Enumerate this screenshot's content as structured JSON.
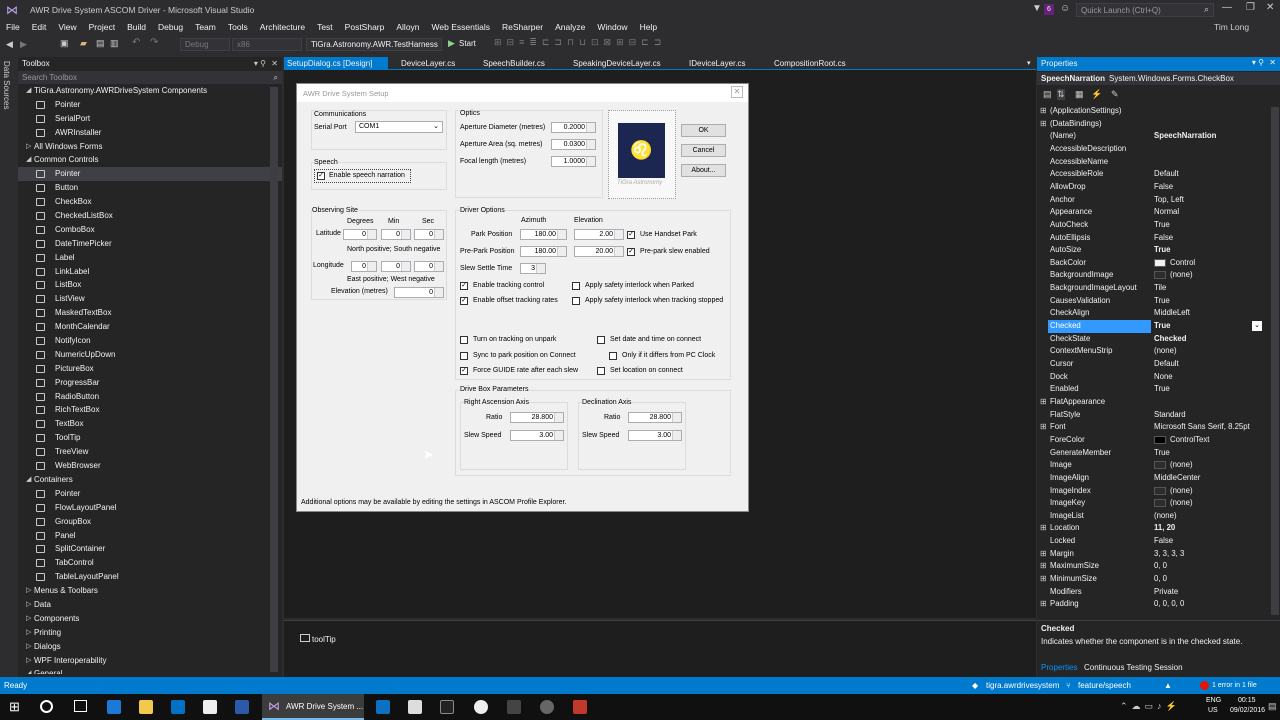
{
  "window": {
    "title": "AWR Drive System ASCOM Driver - Microsoft Visual Studio",
    "quick_launch": "Quick Launch (Ctrl+Q)",
    "user": "Tim Long",
    "notif_count": "6"
  },
  "menu": [
    "File",
    "Edit",
    "View",
    "Project",
    "Build",
    "Debug",
    "Team",
    "Tools",
    "Architecture",
    "Test",
    "PostSharp",
    "Alloyn",
    "Web Essentials",
    "ReSharper",
    "Analyze",
    "Window",
    "Help"
  ],
  "toolbar": {
    "config": "Debug",
    "platform": "x86",
    "startup": "TiGra.Astronomy.AWR.TestHarness",
    "start": "Start"
  },
  "sidestrip": {
    "label": "Data Sources"
  },
  "toolbox": {
    "title": "Toolbox",
    "search": "Search Toolbox",
    "items": [
      {
        "t": "TiGra.Astronomy.AWRDriveSystem Components",
        "lvl": 0,
        "grp": true
      },
      {
        "t": "Pointer",
        "lvl": 1
      },
      {
        "t": "SerialPort",
        "lvl": 1
      },
      {
        "t": "AWRInstaller",
        "lvl": 1
      },
      {
        "t": "All Windows Forms",
        "lvl": 0,
        "grp": true,
        "col": true
      },
      {
        "t": "Common Controls",
        "lvl": 0,
        "grp": true
      },
      {
        "t": "Pointer",
        "lvl": 1,
        "sel": true
      },
      {
        "t": "Button",
        "lvl": 1
      },
      {
        "t": "CheckBox",
        "lvl": 1
      },
      {
        "t": "CheckedListBox",
        "lvl": 1
      },
      {
        "t": "ComboBox",
        "lvl": 1
      },
      {
        "t": "DateTimePicker",
        "lvl": 1
      },
      {
        "t": "Label",
        "lvl": 1
      },
      {
        "t": "LinkLabel",
        "lvl": 1
      },
      {
        "t": "ListBox",
        "lvl": 1
      },
      {
        "t": "ListView",
        "lvl": 1
      },
      {
        "t": "MaskedTextBox",
        "lvl": 1
      },
      {
        "t": "MonthCalendar",
        "lvl": 1
      },
      {
        "t": "NotifyIcon",
        "lvl": 1
      },
      {
        "t": "NumericUpDown",
        "lvl": 1
      },
      {
        "t": "PictureBox",
        "lvl": 1
      },
      {
        "t": "ProgressBar",
        "lvl": 1
      },
      {
        "t": "RadioButton",
        "lvl": 1
      },
      {
        "t": "RichTextBox",
        "lvl": 1
      },
      {
        "t": "TextBox",
        "lvl": 1
      },
      {
        "t": "ToolTip",
        "lvl": 1
      },
      {
        "t": "TreeView",
        "lvl": 1
      },
      {
        "t": "WebBrowser",
        "lvl": 1
      },
      {
        "t": "Containers",
        "lvl": 0,
        "grp": true
      },
      {
        "t": "Pointer",
        "lvl": 1
      },
      {
        "t": "FlowLayoutPanel",
        "lvl": 1
      },
      {
        "t": "GroupBox",
        "lvl": 1
      },
      {
        "t": "Panel",
        "lvl": 1
      },
      {
        "t": "SplitContainer",
        "lvl": 1
      },
      {
        "t": "TabControl",
        "lvl": 1
      },
      {
        "t": "TableLayoutPanel",
        "lvl": 1
      },
      {
        "t": "Menus & Toolbars",
        "lvl": 0,
        "grp": true,
        "col": true
      },
      {
        "t": "Data",
        "lvl": 0,
        "grp": true,
        "col": true
      },
      {
        "t": "Components",
        "lvl": 0,
        "grp": true,
        "col": true
      },
      {
        "t": "Printing",
        "lvl": 0,
        "grp": true,
        "col": true
      },
      {
        "t": "Dialogs",
        "lvl": 0,
        "grp": true,
        "col": true
      },
      {
        "t": "WPF Interoperability",
        "lvl": 0,
        "grp": true,
        "col": true
      },
      {
        "t": "General",
        "lvl": 0,
        "grp": true
      }
    ]
  },
  "tabs": [
    "SetupDialog.cs [Design]",
    "DeviceLayer.cs",
    "SpeechBuilder.cs",
    "SpeakingDeviceLayer.cs",
    "IDeviceLayer.cs",
    "CompositionRoot.cs"
  ],
  "dialog": {
    "title": "AWR Drive System Setup",
    "comms": {
      "title": "Communications",
      "port_label": "Serial Port",
      "port": "COM1"
    },
    "speech": {
      "title": "Speech",
      "enable": "Enable speech narration"
    },
    "optics": {
      "title": "Optics",
      "ap_diam": "Aperture Diameter (metres)",
      "ap_diam_v": "0.2000",
      "ap_area": "Aperture Area (sq. metres)",
      "ap_area_v": "0.0300",
      "focal": "Focal length (metres)",
      "focal_v": "1.0000"
    },
    "logo_caption": "TiGra Astronomy",
    "ok": "OK",
    "cancel": "Cancel",
    "about": "About...",
    "site": {
      "title": "Observing Site",
      "deg": "Degrees",
      "min": "Min",
      "sec": "Sec",
      "lat": "Latitude",
      "lon": "Longitude",
      "ns": "North positive; South negative",
      "ew": "East positive; West negative",
      "elev": "Elevation (metres)",
      "v0": "0"
    },
    "driver": {
      "title": "Driver Options",
      "az": "Azimuth",
      "el": "Elevation",
      "park": "Park Position",
      "park_az": "180.00",
      "park_el": "2.00",
      "prepark": "Pre-Park Position",
      "prepark_az": "180.00",
      "prepark_el": "20.00",
      "settle": "Slew Settle Time",
      "settle_v": "3",
      "handset": "Use Handset Park",
      "preslew": "Pre-park slew enabled",
      "track": "Enable tracking control",
      "offset": "Enable offset tracking rates",
      "safe_park": "Apply safety interlock when Parked",
      "safe_stop": "Apply safety interlock when tracking stopped",
      "unpark": "Turn on tracking on unpark",
      "sync": "Sync to park position on Connect",
      "guide": "Force GUIDE rate after each slew",
      "setdate": "Set date and time on connect",
      "ifdiff": "Only if it differs from PC Clock",
      "setloc": "Set location on connect"
    },
    "drive": {
      "title": "Drive Box Parameters",
      "ra": "Right Ascension Axis",
      "dec": "Declination Axis",
      "ratio": "Ratio",
      "ratio_v": "28.800",
      "slew": "Slew Speed",
      "slew_v": "3.00"
    },
    "footer": "Additional options may be available by editing the settings in ASCOM Profile Explorer."
  },
  "tray": {
    "item": "toolTip"
  },
  "props": {
    "title": "Properties",
    "object": "SpeechNarration",
    "type": "System.Windows.Forms.CheckBox",
    "rows": [
      {
        "n": "(ApplicationSettings)",
        "v": "",
        "cat": true
      },
      {
        "n": "(DataBindings)",
        "v": "",
        "cat": true
      },
      {
        "n": "(Name)",
        "v": "SpeechNarration",
        "b": true
      },
      {
        "n": "AccessibleDescription",
        "v": ""
      },
      {
        "n": "AccessibleName",
        "v": ""
      },
      {
        "n": "AccessibleRole",
        "v": "Default"
      },
      {
        "n": "AllowDrop",
        "v": "False"
      },
      {
        "n": "Anchor",
        "v": "Top, Left"
      },
      {
        "n": "Appearance",
        "v": "Normal"
      },
      {
        "n": "AutoCheck",
        "v": "True"
      },
      {
        "n": "AutoEllipsis",
        "v": "False"
      },
      {
        "n": "AutoSize",
        "v": "True",
        "b": true
      },
      {
        "n": "BackColor",
        "v": "Control",
        "sw": "#f0f0f0"
      },
      {
        "n": "BackgroundImage",
        "v": "(none)",
        "sw": "#2d2d30"
      },
      {
        "n": "BackgroundImageLayout",
        "v": "Tile"
      },
      {
        "n": "CausesValidation",
        "v": "True"
      },
      {
        "n": "CheckAlign",
        "v": "MiddleLeft"
      },
      {
        "n": "Checked",
        "v": "True",
        "b": true,
        "sel": true
      },
      {
        "n": "CheckState",
        "v": "Checked",
        "b": true
      },
      {
        "n": "ContextMenuStrip",
        "v": "(none)"
      },
      {
        "n": "Cursor",
        "v": "Default"
      },
      {
        "n": "Dock",
        "v": "None"
      },
      {
        "n": "Enabled",
        "v": "True"
      },
      {
        "n": "FlatAppearance",
        "v": "",
        "cat": true
      },
      {
        "n": "FlatStyle",
        "v": "Standard"
      },
      {
        "n": "Font",
        "v": "Microsoft Sans Serif, 8.25pt",
        "cat": true
      },
      {
        "n": "ForeColor",
        "v": "ControlText",
        "sw": "#000000"
      },
      {
        "n": "GenerateMember",
        "v": "True"
      },
      {
        "n": "Image",
        "v": "(none)",
        "sw": "#2d2d30"
      },
      {
        "n": "ImageAlign",
        "v": "MiddleCenter"
      },
      {
        "n": "ImageIndex",
        "v": "(none)",
        "sw": "#2d2d30"
      },
      {
        "n": "ImageKey",
        "v": "(none)",
        "sw": "#2d2d30"
      },
      {
        "n": "ImageList",
        "v": "(none)"
      },
      {
        "n": "Location",
        "v": "11, 20",
        "cat": true,
        "b": true
      },
      {
        "n": "Locked",
        "v": "False"
      },
      {
        "n": "Margin",
        "v": "3, 3, 3, 3",
        "cat": true
      },
      {
        "n": "MaximumSize",
        "v": "0, 0",
        "cat": true
      },
      {
        "n": "MinimumSize",
        "v": "0, 0",
        "cat": true
      },
      {
        "n": "Modifiers",
        "v": "Private"
      },
      {
        "n": "Padding",
        "v": "0, 0, 0, 0",
        "cat": true
      }
    ],
    "desc_title": "Checked",
    "desc": "Indicates whether the component is in the checked state.",
    "tab1": "Properties",
    "tab2": "Continuous Testing Session"
  },
  "status": {
    "left": "Ready",
    "repo": "tigra.awrdrivesystem",
    "branch": "feature/speech",
    "errors": "1 error in 1 file"
  },
  "taskbar": {
    "app": "AWR Drive System ...",
    "lang": "ENG",
    "region": "US",
    "time": "00:15",
    "date": "09/02/2016"
  }
}
